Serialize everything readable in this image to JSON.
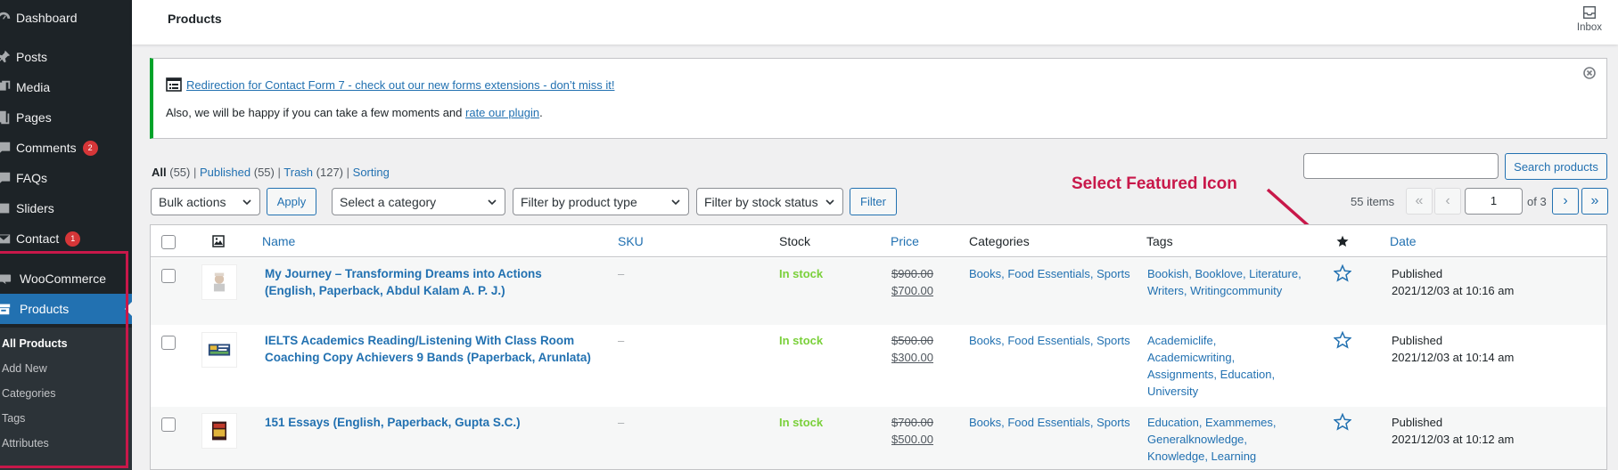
{
  "sidebar": {
    "items": [
      {
        "label": "Dashboard",
        "icon": "dashboard-icon"
      },
      {
        "label": "Posts",
        "icon": "pin-icon"
      },
      {
        "label": "Media",
        "icon": "media-icon"
      },
      {
        "label": "Pages",
        "icon": "pages-icon"
      },
      {
        "label": "Comments",
        "icon": "comments-icon",
        "badge": "2"
      },
      {
        "label": "FAQs",
        "icon": "chat-icon"
      },
      {
        "label": "Sliders",
        "icon": "slider-icon"
      },
      {
        "label": "Contact",
        "icon": "mail-icon",
        "badge": "1"
      },
      {
        "label": "WooCommerce",
        "icon": "woocommerce-icon"
      },
      {
        "label": "Products",
        "icon": "archive-icon"
      }
    ],
    "submenu": [
      "All Products",
      "Add New",
      "Categories",
      "Tags",
      "Attributes"
    ]
  },
  "topbar": {
    "title": "Products",
    "inbox": "Inbox"
  },
  "notice": {
    "link": "Redirection for Contact Form 7 - check out our new forms extensions - don’t miss it!",
    "text": "Also, we will be happy if you can take a few moments and ",
    "link2": "rate our plugin",
    "tail": "."
  },
  "views": {
    "all": "All",
    "all_count": "(55)",
    "published": "Published",
    "published_count": "(55)",
    "trash": "Trash",
    "trash_count": "(127)",
    "sorting": "Sorting",
    "sep": "|"
  },
  "toolbar": {
    "search_button": "Search products",
    "bulk": "Bulk actions",
    "apply": "Apply",
    "category": "Select a category",
    "type": "Filter by product type",
    "stock": "Filter by stock status",
    "filter": "Filter",
    "items": "55 items",
    "first": "«",
    "prev": "‹",
    "page": "1",
    "of": "of 3",
    "next": "›",
    "last": "»"
  },
  "annotation": "Select Featured Icon",
  "columns": {
    "name": "Name",
    "sku": "SKU",
    "stock": "Stock",
    "price": "Price",
    "categories": "Categories",
    "tags": "Tags",
    "date": "Date"
  },
  "rows": [
    {
      "name_l1": "My Journey – Transforming Dreams into Actions",
      "name_l2": "(English, Paperback, Abdul Kalam A. P. J.)",
      "sku": "–",
      "stock": "In stock",
      "regular": "$900.00",
      "sale": "$700.00",
      "categories": "Books, Food Essentials, Sports",
      "tags_l1": "Bookish, Booklove, Literature,",
      "tags_l2": "Writers, Writingcommunity",
      "tags_l3": "",
      "tags_l4": "",
      "status": "Published",
      "date": "2021/12/03 at 10:16 am"
    },
    {
      "name_l1": "IELTS Academics Reading/Listening With Class Room",
      "name_l2": "Coaching Copy Achievers 9 Bands (Paperback, Arunlata)",
      "sku": "–",
      "stock": "In stock",
      "regular": "$500.00",
      "sale": "$300.00",
      "categories": "Books, Food Essentials, Sports",
      "tags_l1": "Academiclife,",
      "tags_l2": "Academicwriting,",
      "tags_l3": "Assignments, Education,",
      "tags_l4": "University",
      "status": "Published",
      "date": "2021/12/03 at 10:14 am"
    },
    {
      "name_l1": "151 Essays (English, Paperback, Gupta S.C.)",
      "name_l2": "",
      "sku": "–",
      "stock": "In stock",
      "regular": "$700.00",
      "sale": "$500.00",
      "categories": "Books, Food Essentials, Sports",
      "tags_l1": "Education, Exammemes,",
      "tags_l2": "Generalknowledge,",
      "tags_l3": "Knowledge, Learning",
      "tags_l4": "",
      "status": "Published",
      "date": "2021/12/03 at 10:12 am"
    }
  ],
  "colors": {
    "accent": "#2271b1",
    "sidebar": "#1d2327",
    "annotation": "#c8184a",
    "instock": "#7ad03a"
  }
}
